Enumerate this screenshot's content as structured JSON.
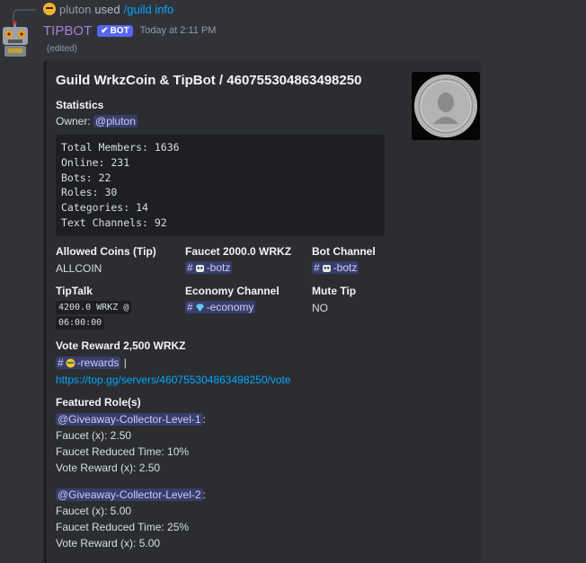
{
  "reply": {
    "user": "pluton",
    "used": "used",
    "command": "/guild info"
  },
  "message": {
    "username": "TIPBOT",
    "badge": "BOT",
    "timestamp": "Today at 2:11 PM",
    "edited": "(edited)",
    "avatar_icon": "robot-avatar-icon"
  },
  "embed": {
    "title": "Guild WrkzCoin & TipBot / 460755304863498250",
    "statistics_label": "Statistics",
    "owner_label": "Owner:",
    "owner_mention": "@pluton",
    "stats_lines": [
      "Total Members: 1636",
      "Online: 231",
      "Bots: 22",
      "Roles: 30",
      "Categories: 14",
      "Text Channels: 92"
    ],
    "fields": {
      "allowed_coins": {
        "name": "Allowed Coins (Tip)",
        "value": "ALLCOIN"
      },
      "faucet": {
        "name": "Faucet 2000.0 WRKZ",
        "channel": "-botz"
      },
      "bot_channel": {
        "name": "Bot Channel",
        "channel": "-botz"
      },
      "tiptalk": {
        "name": "TipTalk",
        "code1": "4200.0 WRKZ @",
        "code2": "06:00:00"
      },
      "economy": {
        "name": "Economy Channel",
        "channel": "-economy"
      },
      "mute_tip": {
        "name": "Mute Tip",
        "value": "NO"
      }
    },
    "vote": {
      "name": "Vote Reward 2,500 WRKZ",
      "channel": "-rewards",
      "separator": "|",
      "link": "https://top.gg/servers/460755304863498250/vote"
    },
    "featured": {
      "name": "Featured Role(s)",
      "roles": [
        {
          "mention": "@Giveaway-Collector-Level-1",
          "colon": ":",
          "faucet": "Faucet (x): 2.50",
          "reduced": "Faucet Reduced Time: 10%",
          "vote": "Vote Reward (x): 2.50"
        },
        {
          "mention": "@Giveaway-Collector-Level-2",
          "colon": ":",
          "faucet": "Faucet (x): 5.00",
          "reduced": "Faucet Reduced Time: 25%",
          "vote": "Vote Reward (x): 5.00"
        }
      ]
    }
  },
  "colors": {
    "background": "#313338",
    "embed_bg": "#2b2d31",
    "username": "#a97dd8",
    "link": "#00a8fc",
    "mention_bg": "#5865f2"
  }
}
